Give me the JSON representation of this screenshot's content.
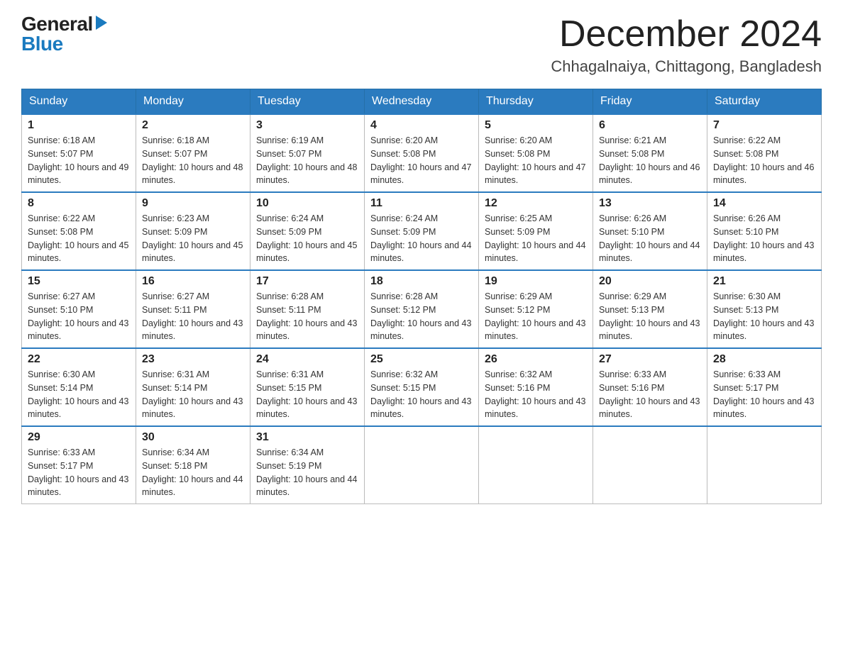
{
  "header": {
    "logo_general": "General",
    "logo_blue": "Blue",
    "month_title": "December 2024",
    "location": "Chhagalnaiya, Chittagong, Bangladesh"
  },
  "days_of_week": [
    "Sunday",
    "Monday",
    "Tuesday",
    "Wednesday",
    "Thursday",
    "Friday",
    "Saturday"
  ],
  "weeks": [
    [
      {
        "day": "1",
        "sunrise": "6:18 AM",
        "sunset": "5:07 PM",
        "daylight": "10 hours and 49 minutes."
      },
      {
        "day": "2",
        "sunrise": "6:18 AM",
        "sunset": "5:07 PM",
        "daylight": "10 hours and 48 minutes."
      },
      {
        "day": "3",
        "sunrise": "6:19 AM",
        "sunset": "5:07 PM",
        "daylight": "10 hours and 48 minutes."
      },
      {
        "day": "4",
        "sunrise": "6:20 AM",
        "sunset": "5:08 PM",
        "daylight": "10 hours and 47 minutes."
      },
      {
        "day": "5",
        "sunrise": "6:20 AM",
        "sunset": "5:08 PM",
        "daylight": "10 hours and 47 minutes."
      },
      {
        "day": "6",
        "sunrise": "6:21 AM",
        "sunset": "5:08 PM",
        "daylight": "10 hours and 46 minutes."
      },
      {
        "day": "7",
        "sunrise": "6:22 AM",
        "sunset": "5:08 PM",
        "daylight": "10 hours and 46 minutes."
      }
    ],
    [
      {
        "day": "8",
        "sunrise": "6:22 AM",
        "sunset": "5:08 PM",
        "daylight": "10 hours and 45 minutes."
      },
      {
        "day": "9",
        "sunrise": "6:23 AM",
        "sunset": "5:09 PM",
        "daylight": "10 hours and 45 minutes."
      },
      {
        "day": "10",
        "sunrise": "6:24 AM",
        "sunset": "5:09 PM",
        "daylight": "10 hours and 45 minutes."
      },
      {
        "day": "11",
        "sunrise": "6:24 AM",
        "sunset": "5:09 PM",
        "daylight": "10 hours and 44 minutes."
      },
      {
        "day": "12",
        "sunrise": "6:25 AM",
        "sunset": "5:09 PM",
        "daylight": "10 hours and 44 minutes."
      },
      {
        "day": "13",
        "sunrise": "6:26 AM",
        "sunset": "5:10 PM",
        "daylight": "10 hours and 44 minutes."
      },
      {
        "day": "14",
        "sunrise": "6:26 AM",
        "sunset": "5:10 PM",
        "daylight": "10 hours and 43 minutes."
      }
    ],
    [
      {
        "day": "15",
        "sunrise": "6:27 AM",
        "sunset": "5:10 PM",
        "daylight": "10 hours and 43 minutes."
      },
      {
        "day": "16",
        "sunrise": "6:27 AM",
        "sunset": "5:11 PM",
        "daylight": "10 hours and 43 minutes."
      },
      {
        "day": "17",
        "sunrise": "6:28 AM",
        "sunset": "5:11 PM",
        "daylight": "10 hours and 43 minutes."
      },
      {
        "day": "18",
        "sunrise": "6:28 AM",
        "sunset": "5:12 PM",
        "daylight": "10 hours and 43 minutes."
      },
      {
        "day": "19",
        "sunrise": "6:29 AM",
        "sunset": "5:12 PM",
        "daylight": "10 hours and 43 minutes."
      },
      {
        "day": "20",
        "sunrise": "6:29 AM",
        "sunset": "5:13 PM",
        "daylight": "10 hours and 43 minutes."
      },
      {
        "day": "21",
        "sunrise": "6:30 AM",
        "sunset": "5:13 PM",
        "daylight": "10 hours and 43 minutes."
      }
    ],
    [
      {
        "day": "22",
        "sunrise": "6:30 AM",
        "sunset": "5:14 PM",
        "daylight": "10 hours and 43 minutes."
      },
      {
        "day": "23",
        "sunrise": "6:31 AM",
        "sunset": "5:14 PM",
        "daylight": "10 hours and 43 minutes."
      },
      {
        "day": "24",
        "sunrise": "6:31 AM",
        "sunset": "5:15 PM",
        "daylight": "10 hours and 43 minutes."
      },
      {
        "day": "25",
        "sunrise": "6:32 AM",
        "sunset": "5:15 PM",
        "daylight": "10 hours and 43 minutes."
      },
      {
        "day": "26",
        "sunrise": "6:32 AM",
        "sunset": "5:16 PM",
        "daylight": "10 hours and 43 minutes."
      },
      {
        "day": "27",
        "sunrise": "6:33 AM",
        "sunset": "5:16 PM",
        "daylight": "10 hours and 43 minutes."
      },
      {
        "day": "28",
        "sunrise": "6:33 AM",
        "sunset": "5:17 PM",
        "daylight": "10 hours and 43 minutes."
      }
    ],
    [
      {
        "day": "29",
        "sunrise": "6:33 AM",
        "sunset": "5:17 PM",
        "daylight": "10 hours and 43 minutes."
      },
      {
        "day": "30",
        "sunrise": "6:34 AM",
        "sunset": "5:18 PM",
        "daylight": "10 hours and 44 minutes."
      },
      {
        "day": "31",
        "sunrise": "6:34 AM",
        "sunset": "5:19 PM",
        "daylight": "10 hours and 44 minutes."
      },
      null,
      null,
      null,
      null
    ]
  ]
}
